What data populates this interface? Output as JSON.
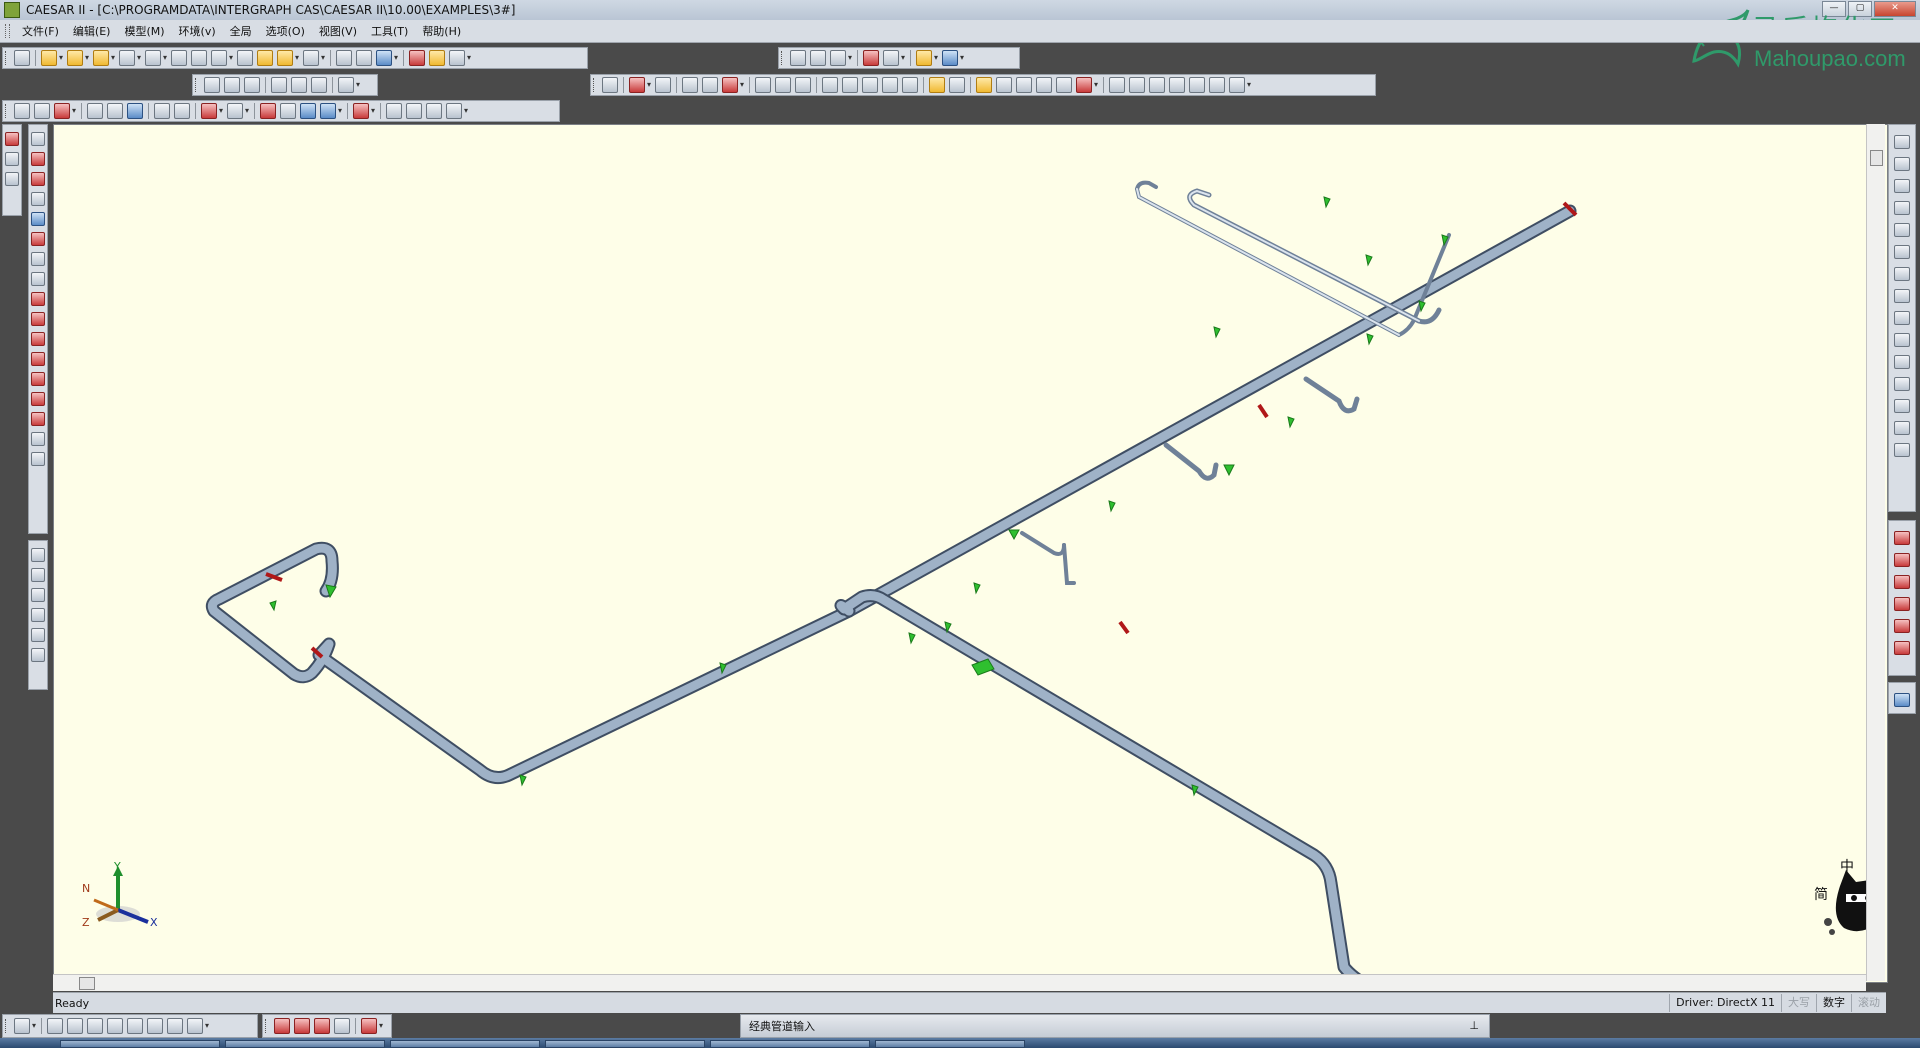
{
  "window": {
    "title": "CAESAR II - [C:\\PROGRAMDATA\\INTERGRAPH CAS\\CAESAR II\\10.00\\EXAMPLES\\3#]",
    "min_label": "—",
    "max_label": "▢",
    "close_label": "✕"
  },
  "menu": [
    "文件(F)",
    "编辑(E)",
    "模型(M)",
    "环境(v)",
    "全局",
    "选项(O)",
    "视图(V)",
    "工具(T)",
    "帮助(H)"
  ],
  "watermark": {
    "cn": "马后炮化工",
    "en": "Mahoupao.com"
  },
  "viewport": {
    "background": "#fefee8",
    "pipe_color": "#8fa3ba",
    "support_color": "#2fbf2f",
    "flange_color": "#b01818"
  },
  "triad": {
    "y": "Y",
    "x": "X",
    "z": "Z",
    "n": "N"
  },
  "ime": {
    "top": "中",
    "left": "简"
  },
  "status": {
    "left": "Ready",
    "driver": "Driver: DirectX 11",
    "caps": "大写",
    "num": "数字",
    "scroll": "滚动"
  },
  "panel": {
    "title": "经典管道输入",
    "pin": "⊥"
  }
}
